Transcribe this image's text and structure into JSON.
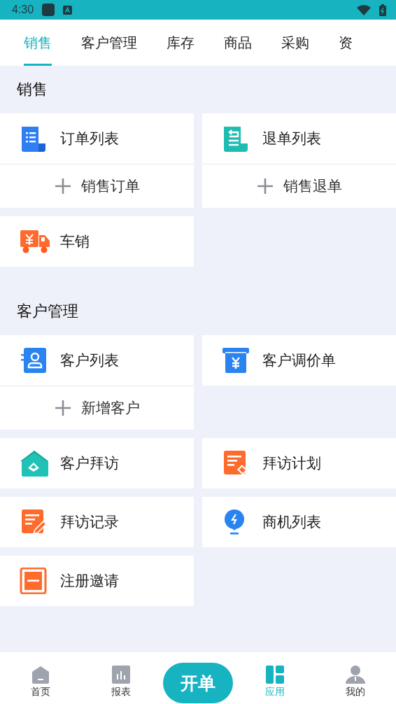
{
  "status_bar": {
    "time": "4:30"
  },
  "tabs": [
    {
      "label": "销售",
      "selected": true
    },
    {
      "label": "客户管理",
      "selected": false
    },
    {
      "label": "库存",
      "selected": false
    },
    {
      "label": "商品",
      "selected": false
    },
    {
      "label": "采购",
      "selected": false
    },
    {
      "label": "资",
      "selected": false
    }
  ],
  "sections": [
    {
      "title": "销售",
      "items": [
        {
          "label": "订单列表",
          "add": "销售订单"
        },
        {
          "label": "退单列表",
          "add": "销售退单"
        },
        {
          "label": "车销"
        }
      ]
    },
    {
      "title": "客户管理",
      "items": [
        {
          "label": "客户列表",
          "add": "新增客户"
        },
        {
          "label": "客户调价单"
        },
        {
          "label": "客户拜访"
        },
        {
          "label": "拜访计划"
        },
        {
          "label": "拜访记录"
        },
        {
          "label": "商机列表"
        },
        {
          "label": "注册邀请"
        }
      ]
    }
  ],
  "bottom_nav": [
    {
      "label": "首页",
      "kind": "tab",
      "selected": false
    },
    {
      "label": "报表",
      "kind": "tab",
      "selected": false
    },
    {
      "label": "开单",
      "kind": "primary"
    },
    {
      "label": "应用",
      "kind": "tab",
      "selected": true
    },
    {
      "label": "我的",
      "kind": "tab",
      "selected": false
    }
  ]
}
